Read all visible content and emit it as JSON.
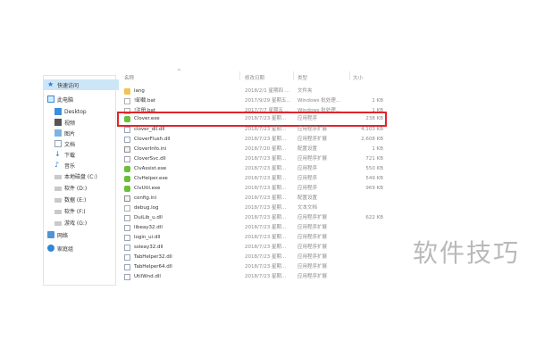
{
  "nav": {
    "items": [
      {
        "label": "快速访问",
        "icon": "star-icon"
      },
      {
        "label": "此电脑",
        "icon": "computer-icon"
      },
      {
        "label": "Desktop",
        "icon": "desktop-folder-icon"
      },
      {
        "label": "视频",
        "icon": "video-folder-icon"
      },
      {
        "label": "图片",
        "icon": "picture-folder-icon"
      },
      {
        "label": "文档",
        "icon": "document-folder-icon"
      },
      {
        "label": "下载",
        "icon": "download-icon"
      },
      {
        "label": "音乐",
        "icon": "music-icon"
      },
      {
        "label": "本地磁盘 (C:)",
        "icon": "drive-icon"
      },
      {
        "label": "软件 (D:)",
        "icon": "drive-icon"
      },
      {
        "label": "数据 (E:)",
        "icon": "drive-icon"
      },
      {
        "label": "软件 (F:)",
        "icon": "drive-icon"
      },
      {
        "label": "游戏 (G:)",
        "icon": "drive-icon"
      },
      {
        "label": "网络",
        "icon": "network-icon"
      },
      {
        "label": "家庭组",
        "icon": "homegroup-icon"
      }
    ]
  },
  "columns": {
    "name": "名称",
    "date": "修改日期",
    "type": "类型",
    "size": "大小"
  },
  "files": [
    {
      "name": "lang",
      "date": "2018/2/1 星期四 ...",
      "type": "文件夹",
      "size": "",
      "icon": "folder-icon"
    },
    {
      "name": "!卸载.bat",
      "date": "2017/9/29 星期五...",
      "type": "Windows 批处理...",
      "size": "1 KB",
      "icon": "text-file-icon"
    },
    {
      "name": "!注册.bat",
      "date": "2017/7/7 星期五 ...",
      "type": "Windows 批处理...",
      "size": "1 KB",
      "icon": "text-file-icon"
    },
    {
      "name": "Clover.exe",
      "date": "2018/7/23 星期...",
      "type": "应用程序",
      "size": "238 KB",
      "icon": "clover-app-icon"
    },
    {
      "name": "clover_dll.dll",
      "date": "2018/7/23 星期...",
      "type": "应用程序扩展",
      "size": "4,103 KB",
      "icon": "dll-file-icon"
    },
    {
      "name": "CloverFlush.dll",
      "date": "2018/7/23 星期...",
      "type": "应用程序扩展",
      "size": "2,608 KB",
      "icon": "dll-file-icon"
    },
    {
      "name": "CloverInfo.ini",
      "date": "2018/7/20 星期...",
      "type": "配置设置",
      "size": "1 KB",
      "icon": "config-file-icon"
    },
    {
      "name": "CloverSvc.dll",
      "date": "2018/7/23 星期...",
      "type": "应用程序扩展",
      "size": "721 KB",
      "icon": "dll-file-icon"
    },
    {
      "name": "ClvAssist.exe",
      "date": "2018/7/23 星期...",
      "type": "应用程序",
      "size": "550 KB",
      "icon": "clover-app-icon"
    },
    {
      "name": "ClvHelper.exe",
      "date": "2018/7/23 星期...",
      "type": "应用程序",
      "size": "549 KB",
      "icon": "clover-app-icon"
    },
    {
      "name": "ClvUtil.exe",
      "date": "2018/7/23 星期...",
      "type": "应用程序",
      "size": "969 KB",
      "icon": "clover-app-icon"
    },
    {
      "name": "config.ini",
      "date": "2018/7/23 星期...",
      "type": "配置设置",
      "size": "",
      "icon": "config-file-icon"
    },
    {
      "name": "debug.log",
      "date": "2018/7/23 星期...",
      "type": "文本文档",
      "size": "",
      "icon": "text-file-icon"
    },
    {
      "name": "DuiLib_u.dll",
      "date": "2018/7/23 星期...",
      "type": "应用程序扩展",
      "size": "622 KB",
      "icon": "dll-file-icon"
    },
    {
      "name": "libeay32.dll",
      "date": "2018/7/23 星期...",
      "type": "应用程序扩展",
      "size": "",
      "icon": "dll-file-icon"
    },
    {
      "name": "login_ui.dll",
      "date": "2018/7/23 星期...",
      "type": "应用程序扩展",
      "size": "",
      "icon": "dll-file-icon"
    },
    {
      "name": "ssleay32.dll",
      "date": "2018/7/23 星期...",
      "type": "应用程序扩展",
      "size": "",
      "icon": "dll-file-icon"
    },
    {
      "name": "TabHelper32.dll",
      "date": "2018/7/23 星期...",
      "type": "应用程序扩展",
      "size": "",
      "icon": "dll-file-icon"
    },
    {
      "name": "TabHelper64.dll",
      "date": "2018/7/23 星期...",
      "type": "应用程序扩展",
      "size": "",
      "icon": "dll-file-icon"
    },
    {
      "name": "UtilWnd.dll",
      "date": "2018/7/23 星期...",
      "type": "应用程序扩展",
      "size": "",
      "icon": "dll-file-icon"
    }
  ],
  "highlighted_file": "Clover.exe",
  "watermark": "软件技巧",
  "colors": {
    "highlight": "#e0242b",
    "quick_access_bg": "#cde6f7",
    "exe_icon": "#6bbf3a",
    "folder_icon": "#f2c354"
  }
}
